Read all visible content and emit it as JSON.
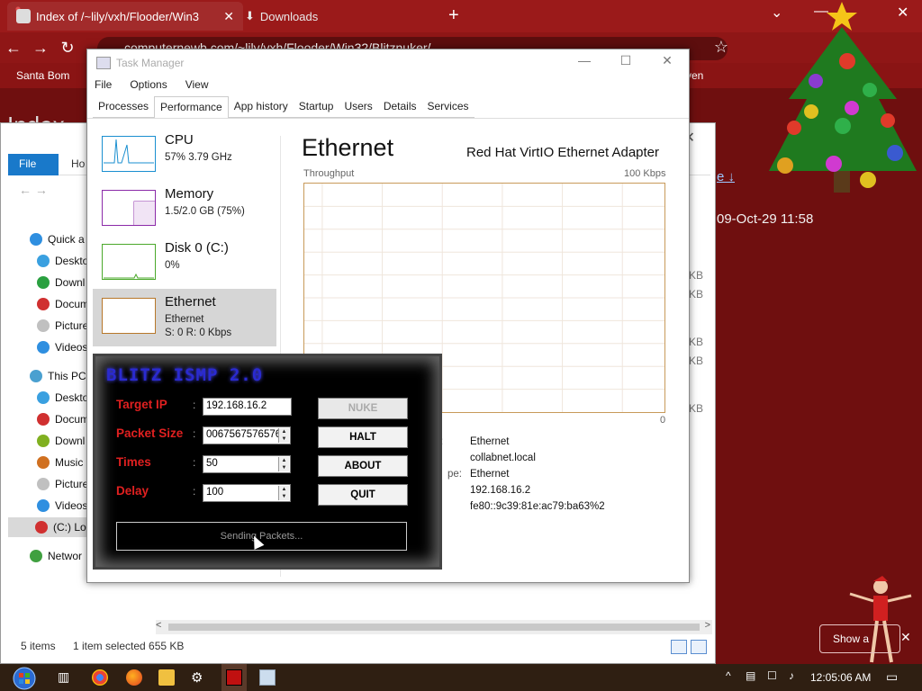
{
  "browser": {
    "tabs": [
      {
        "title": "Index of /~lily/vxh/Flooder/Win3",
        "active": true
      },
      {
        "title": "Downloads",
        "active": false
      }
    ],
    "url": "computernewb.com/~lily/vxh/Flooder/Win32/Blitznuker/",
    "bookmarks": [
      "Santa Bom",
      "ven"
    ],
    "page_heading": "Index",
    "page_link": "e ↓",
    "page_date": "09-Oct-29 11:58",
    "size_kb": [
      "KB",
      "KB",
      "KB",
      "KB",
      "KB"
    ]
  },
  "explorer": {
    "ribbon": {
      "file": "File",
      "home": "Ho"
    },
    "nav": [
      {
        "label": "Quick a",
        "icon": "star-icon",
        "color": "#2f8fe0"
      },
      {
        "label": "Deskto",
        "icon": "desktop-icon",
        "color": "#3aa0e0"
      },
      {
        "label": "Downl",
        "icon": "downloads-icon",
        "color": "#2aa040"
      },
      {
        "label": "Docum",
        "icon": "documents-icon",
        "color": "#d03030"
      },
      {
        "label": "Picture",
        "icon": "pictures-icon",
        "color": "#c0c0c0"
      },
      {
        "label": "Videos",
        "icon": "videos-icon",
        "color": "#2f8fe0"
      },
      {
        "label": "This PC",
        "icon": "this-pc-icon",
        "color": "#4aa0d0"
      },
      {
        "label": "Deskto",
        "icon": "desktop-icon",
        "color": "#3aa0e0"
      },
      {
        "label": "Docum",
        "icon": "documents-icon",
        "color": "#d03030"
      },
      {
        "label": "Downl",
        "icon": "downloads-icon",
        "color": "#80b020"
      },
      {
        "label": "Music",
        "icon": "music-icon",
        "color": "#d07020"
      },
      {
        "label": "Picture",
        "icon": "pictures-icon",
        "color": "#c0c0c0"
      },
      {
        "label": "Videos",
        "icon": "videos-icon",
        "color": "#2f8fe0"
      },
      {
        "label": "(C:) Lo",
        "icon": "drive-icon",
        "color": "#d03030"
      },
      {
        "label": "Networ",
        "icon": "network-icon",
        "color": "#40a040"
      }
    ],
    "status": {
      "items": "5 items",
      "selected": "1 item selected  655 KB"
    }
  },
  "taskmgr": {
    "title": "Task Manager",
    "menu": [
      "File",
      "Options",
      "View"
    ],
    "tabs": [
      "Processes",
      "Performance",
      "App history",
      "Startup",
      "Users",
      "Details",
      "Services"
    ],
    "active_tab": "Performance",
    "perf_items": [
      {
        "name": "CPU",
        "sub1": "57% 3.79 GHz",
        "sub2": "",
        "color": "#1a8fd0"
      },
      {
        "name": "Memory",
        "sub1": "1.5/2.0 GB (75%)",
        "sub2": "",
        "color": "#8b2aa8"
      },
      {
        "name": "Disk 0 (C:)",
        "sub1": "0%",
        "sub2": "",
        "color": "#4aa82a"
      },
      {
        "name": "Ethernet",
        "sub1": "Ethernet",
        "sub2": "S: 0 R: 0 Kbps",
        "color": "#b7772a"
      }
    ],
    "detail": {
      "title": "Ethernet",
      "adapter": "Red Hat VirtIO Ethernet Adapter",
      "graph_label": "Throughput",
      "graph_max": "100 Kbps",
      "graph_min": "0",
      "props": [
        {
          "label": ":",
          "value": "Ethernet"
        },
        {
          "label": "",
          "value": "collabnet.local"
        },
        {
          "label": "pe:",
          "value": "Ethernet"
        },
        {
          "label": "",
          "value": "192.168.16.2"
        },
        {
          "label": "",
          "value": "fe80::9c39:81e:ac79:ba63%2"
        }
      ]
    }
  },
  "blitz": {
    "title": "BLITZ ISMP 2.0",
    "fields": [
      {
        "label": "Target IP",
        "value": "192.168.16.2",
        "spinner": false
      },
      {
        "label": "Packet Size",
        "value": "0067567576576",
        "spinner": true
      },
      {
        "label": "Times",
        "value": "50",
        "spinner": true
      },
      {
        "label": "Delay",
        "value": "100",
        "spinner": true
      }
    ],
    "buttons": [
      {
        "label": "NUKE",
        "disabled": true
      },
      {
        "label": "HALT",
        "disabled": false
      },
      {
        "label": "ABOUT",
        "disabled": false
      },
      {
        "label": "QUIT",
        "disabled": false
      }
    ],
    "status": "Sending Packets..."
  },
  "downloads_bar": {
    "show_all": "Show a"
  },
  "taskbar": {
    "clock": "12:05:06 AM"
  }
}
